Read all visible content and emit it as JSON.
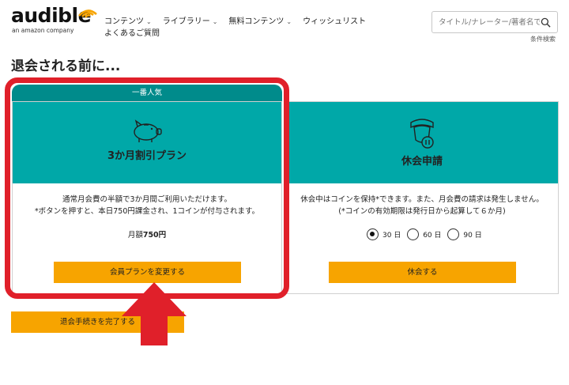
{
  "header": {
    "logo_word": "audible",
    "logo_sub": "an amazon company",
    "nav": [
      {
        "label": "コンテンツ",
        "has_dropdown": true
      },
      {
        "label": "ライブラリー",
        "has_dropdown": true
      },
      {
        "label": "無料コンテンツ",
        "has_dropdown": true
      },
      {
        "label": "ウィッシュリスト",
        "has_dropdown": false
      },
      {
        "label": "よくあるご質問",
        "has_dropdown": false
      }
    ],
    "search_placeholder": "タイトル/ナレーター/著者名で",
    "advanced_search": "条件検索"
  },
  "page_title": "退会される前に...",
  "plan_card": {
    "badge": "一番人気",
    "title": "3か月割引プラン",
    "desc_line1": "通常月会費の半額で3か月間ご利用いただけます。",
    "desc_line2": "*ボタンを押すと、本日750円課金され、1コインが付与されます。",
    "price_prefix": "月額",
    "price_value": "750円",
    "button": "会員プランを変更する"
  },
  "pause_card": {
    "title": "休会申請",
    "desc_line1": "休会中はコインを保持*できます。また、月会費の請求は発生しません。",
    "desc_line2": "(*コインの有効期限は発行日から起算して６か月)",
    "options": [
      {
        "label": "30 日",
        "checked": true
      },
      {
        "label": "60 日",
        "checked": false
      },
      {
        "label": "90 日",
        "checked": false
      }
    ],
    "button": "休会する"
  },
  "complete_button": "退会手続きを完了する",
  "colors": {
    "teal": "#00a8a8",
    "teal_dark": "#008b8b",
    "orange": "#f7a400",
    "highlight_red": "#e0202a"
  }
}
